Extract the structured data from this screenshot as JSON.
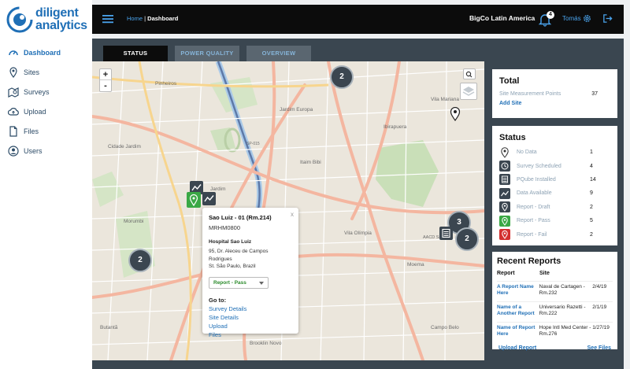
{
  "brand": {
    "line1": "diligent",
    "line2": "analytics"
  },
  "nav": {
    "items": [
      {
        "label": "Dashboard",
        "icon": "dashboard-icon"
      },
      {
        "label": "Sites",
        "icon": "map-pin-icon"
      },
      {
        "label": "Surveys",
        "icon": "survey-icon"
      },
      {
        "label": "Upload",
        "icon": "cloud-upload-icon"
      },
      {
        "label": "Files",
        "icon": "file-icon"
      },
      {
        "label": "Users",
        "icon": "user-icon"
      }
    ]
  },
  "topbar": {
    "home": "Home",
    "separator": "|",
    "page": "Dashboard",
    "company": "BigCo Latin America",
    "notifications": "4",
    "user": "Tomás"
  },
  "tabs": [
    "STATUS",
    "POWER QUALITY",
    "OVERVIEW"
  ],
  "map": {
    "zoom_in": "+",
    "zoom_out": "-",
    "clusters": [
      "2",
      "2",
      "3",
      "2"
    ],
    "labels": [
      "Jardim Europa",
      "Itaim Bibi",
      "Jardim",
      "Morumbi",
      "Brooklin Novo",
      "Ibirapuera",
      "Moema",
      "Vila Mariana",
      "Pinheiros",
      "Cidade Jardim",
      "Vila Olímpia",
      "Butantã",
      "Campo Belo",
      "AACD Servidor",
      "SP-015"
    ]
  },
  "popup": {
    "close": "x",
    "title": "Sao Luiz - 01 (Rm.214)",
    "code": "MRHM0800",
    "hospital": "Hospital Sao Luiz",
    "address1": "95, Dr. Aleceu de Campos Rodrigues",
    "address2": "St. São Paulo, Brazil",
    "select_value": "Report - Pass",
    "goto_label": "Go to:",
    "links": [
      "Survey Details",
      "Site Details",
      "Upload",
      "Files"
    ]
  },
  "total": {
    "title": "Total",
    "label": "Site Measurement Points",
    "value": "37",
    "add_site": "Add Site"
  },
  "status": {
    "title": "Status",
    "rows": [
      {
        "label": "No Data",
        "value": "1",
        "icon": "pin-outline-icon",
        "color": "#ffffff"
      },
      {
        "label": "Survey Scheduled",
        "value": "4",
        "icon": "clock-icon",
        "color": "#3b4650"
      },
      {
        "label": "PQube Installed",
        "value": "14",
        "icon": "device-icon",
        "color": "#3b4650"
      },
      {
        "label": "Data Available",
        "value": "9",
        "icon": "chart-line-icon",
        "color": "#3b4650"
      },
      {
        "label": "Report - Draft",
        "value": "2",
        "icon": "pin-draft-icon",
        "color": "#3b4650"
      },
      {
        "label": "Report - Pass",
        "value": "5",
        "icon": "pin-pass-icon",
        "color": "#3aa845"
      },
      {
        "label": "Report - Fail",
        "value": "2",
        "icon": "pin-fail-icon",
        "color": "#d32f2f"
      }
    ]
  },
  "reports": {
    "title": "Recent Reports",
    "col_report": "Report",
    "col_site": "Site",
    "rows": [
      {
        "report": "A Report Name Here",
        "site": "Naval de Cartagen - Rm.232",
        "date": "2/4/19"
      },
      {
        "report": "Name of a Another Report",
        "site": "Universario Razetti - Rm.222",
        "date": "2/1/19"
      },
      {
        "report": "Name of Report Here",
        "site": "Hope Intl Med Center - Rm.276",
        "date": "1/27/19"
      }
    ],
    "upload": "Upload Report",
    "see_files": "See Files"
  }
}
